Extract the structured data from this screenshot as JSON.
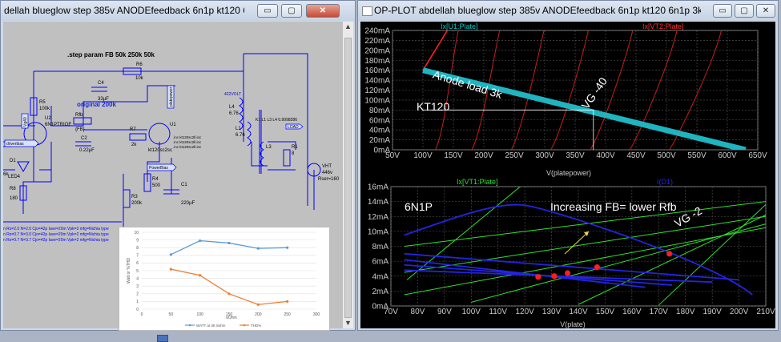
{
  "left_window": {
    "title": "dellah blueglow  step 385v ANODEfeedback 6n1p  kt120 6n1p 3k sh...",
    "buttons": {
      "minimize": "▭",
      "maximize": "▢",
      "close": "✕"
    },
    "schematic": {
      "step_param": ".step param FB 50k 250k 50k",
      "note_original": "original 200k",
      "label_422volt": "422VOLT",
      "coupling": "K1 L1 L3 L4 0.9998286",
      "load": "LOAD",
      "driverbias": "driverbias",
      "powerbias": "PowerBias",
      "platepower": "platepower",
      "vg40_label": "Vg40",
      "parts": [
        {
          "id": "c4",
          "name": "C4",
          "value": "33µF"
        },
        {
          "id": "r6",
          "name": "R6",
          "value": "10k"
        },
        {
          "id": "r5",
          "name": "R5",
          "value": "100k"
        },
        {
          "id": "u2",
          "name": "U2",
          "value": "6N1PTRIOE"
        },
        {
          "id": "rfb",
          "name": "Rfb",
          "value": "{FB}"
        },
        {
          "id": "c2",
          "name": "C2",
          "value": "0.22µF"
        },
        {
          "id": "r7",
          "name": "R7",
          "value": "2k"
        },
        {
          "id": "u1",
          "name": "U1",
          "value": "kt120sc2sc"
        },
        {
          "id": "r3",
          "name": "R3",
          "value": "200k"
        },
        {
          "id": "r4",
          "name": "R4",
          "value": "500"
        },
        {
          "id": "c1",
          "name": "C1",
          "value": "220µF"
        },
        {
          "id": "l4",
          "name": "L4",
          "value": "6.76"
        },
        {
          "id": "l1",
          "name": "L1",
          "value": "6.76"
        },
        {
          "id": "l3",
          "name": "L3",
          "value": ""
        },
        {
          "id": "r1",
          "name": "R1",
          "value": "8"
        },
        {
          "id": "d1",
          "name": "D1",
          "value": "LED4"
        },
        {
          "id": "r8",
          "name": "R8",
          "value": "180"
        },
        {
          "id": "vht",
          "name": "VHT",
          "value": "446v"
        },
        {
          "id": "rser",
          "name": "Rser",
          "value": "Rser=160"
        },
        {
          "id": "k6",
          "name": "",
          "value": "6k"
        }
      ],
      "includes": [
        ".inc kt120sc2ll.inc",
        ".inc kt120sc2ll.inc",
        ".inc kt120sc2ll.inc"
      ],
      "model_lines": [
        "n Rs=2.0 N=2.0 Cjo=42p Iave=20m Vpk=2 mfg=Nichia type",
        "n Rs=0.7 N=3.0 Cjo=42p Iave=20m Vpk=2 mfg=Nichia type",
        "n Rs=0.7 N=3.7 Cjo=42p Iave=20m Vpk=2 mfg=Nichia type"
      ]
    }
  },
  "excel_chart": {
    "chart_data": {
      "type": "line",
      "x": [
        50,
        100,
        150,
        200,
        250
      ],
      "xlabel": "kOhm",
      "ylabel": "Watt or %THD",
      "xlim": [
        0,
        300
      ],
      "ylim": [
        0,
        10
      ],
      "x_ticks": [
        "0",
        "50",
        "100",
        "150",
        "200",
        "250",
        "300"
      ],
      "y_ticks": [
        "0",
        "1",
        "2",
        "3",
        "4",
        "5",
        "6",
        "7",
        "8",
        "9",
        "10"
      ],
      "series": [
        {
          "name": "WATT at 3K 8ohm",
          "color": "#5b9bd5",
          "values": [
            7.1,
            8.9,
            8.6,
            7.9,
            8.0
          ]
        },
        {
          "name": "THD%",
          "color": "#ed7d31",
          "values": [
            5.2,
            4.4,
            2.0,
            0.6,
            1.0
          ]
        }
      ],
      "legend_position": "bottom"
    }
  },
  "right_window": {
    "title": "OP-PLOT abdellah blueglow  step 385v ANODEfeedback 6n1p  kt120 6n1p 3k sh...",
    "buttons": {
      "minimize": "▭",
      "maximize": "▢",
      "close": "✕"
    },
    "plots": [
      {
        "name": "kt120",
        "traces": [
          "Ix[U1:Plate]",
          "Ix[VT2:Plate]"
        ],
        "trace_colors": [
          "#00c8c8",
          "#ff3030"
        ],
        "xlabel": "V(platepower)",
        "x_ticks": [
          "50V",
          "100V",
          "150V",
          "200V",
          "250V",
          "300V",
          "350V",
          "400V",
          "450V",
          "500V",
          "550V",
          "600V",
          "650V"
        ],
        "y_ticks": [
          "0mA",
          "20mA",
          "40mA",
          "60mA",
          "80mA",
          "100mA",
          "120mA",
          "140mA",
          "160mA",
          "180mA",
          "200mA",
          "220mA",
          "240mA"
        ],
        "xlim": [
          50,
          650
        ],
        "ylim": [
          0,
          240
        ],
        "annotations": {
          "load": "Anode load  3k",
          "tube": "KT120",
          "vg": "VG -40"
        },
        "load_line": {
          "from": [
            100,
            160
          ],
          "to": [
            630,
            0
          ]
        },
        "cursor_point": [
          380,
          80
        ]
      },
      {
        "name": "6n1p",
        "traces": [
          "Ix[VT1:Plate]",
          "I(D1)"
        ],
        "trace_colors": [
          "#30e030",
          "#2020ff"
        ],
        "xlabel": "V(plate)",
        "x_ticks": [
          "70V",
          "80V",
          "90V",
          "100V",
          "110V",
          "120V",
          "130V",
          "140V",
          "150V",
          "160V",
          "170V",
          "180V",
          "190V",
          "200V",
          "210V"
        ],
        "y_ticks": [
          "0mA",
          "2mA",
          "4mA",
          "6mA",
          "8mA",
          "10mA",
          "12mA",
          "14mA",
          "16mA"
        ],
        "xlim": [
          70,
          210
        ],
        "ylim": [
          0,
          16
        ],
        "annotations": {
          "tube": "6N1P",
          "fb": "Increasing FB= lower Rfb",
          "vg": "VG -2"
        },
        "operating_points": [
          [
            125,
            3.9
          ],
          [
            131,
            4.0
          ],
          [
            136,
            4.4
          ],
          [
            147,
            5.2
          ],
          [
            174,
            7.0
          ]
        ]
      }
    ]
  }
}
